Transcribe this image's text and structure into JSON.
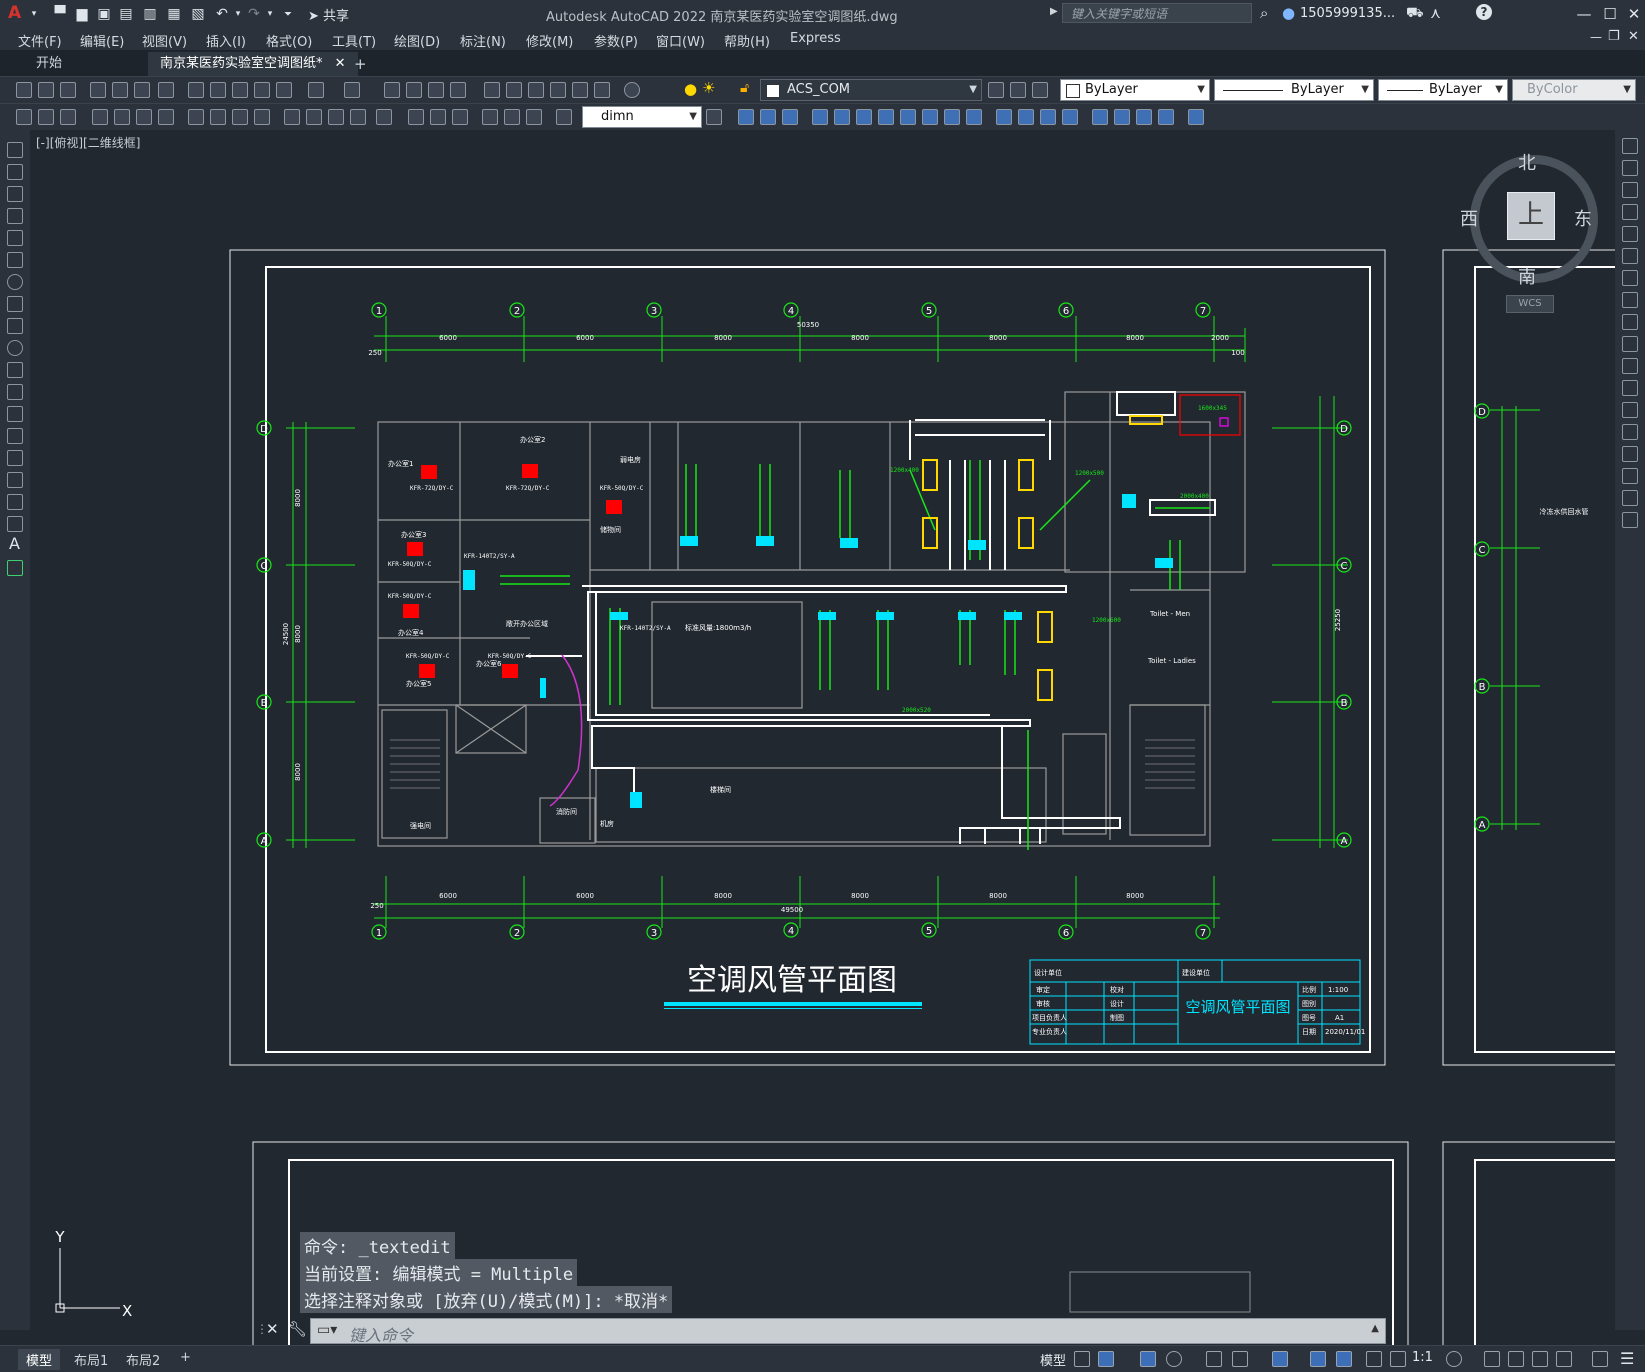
{
  "app": {
    "logo_letter": "A",
    "window_title": "Autodesk AutoCAD 2022    南京某医药实验室空调图纸.dwg",
    "share_label": "共享",
    "search_placeholder": "键入关键字或短语",
    "user_id": "1505999135...",
    "colors": {
      "accent_red": "#d8322c",
      "drawing_bg": "#212830",
      "green": "#19e619",
      "cyan": "#00e5ff",
      "red": "#ff0000",
      "yellow": "#ffd800",
      "white": "#ffffff"
    }
  },
  "menu": [
    "文件(F)",
    "编辑(E)",
    "视图(V)",
    "插入(I)",
    "格式(O)",
    "工具(T)",
    "绘图(D)",
    "标注(N)",
    "修改(M)",
    "参数(P)",
    "窗口(W)",
    "帮助(H)",
    "Express"
  ],
  "tabs": {
    "start": "开始",
    "file": "南京某医药实验室空调图纸*",
    "add": "+"
  },
  "toolbar": {
    "layer": "ACS_COM",
    "color": "ByLayer",
    "linetype": "ByLayer",
    "lineweight": "ByLayer",
    "plotstyle": "ByColor",
    "dimstyle": "dimn"
  },
  "viewport": {
    "label": "[-][俯视][二维线框]"
  },
  "viewcube": {
    "north": "北",
    "south": "南",
    "east": "东",
    "west": "西",
    "face": "上",
    "wcs": "WCS"
  },
  "drawing": {
    "title": "空调风管平面图",
    "axes_numbers": [
      "1",
      "2",
      "3",
      "4",
      "5",
      "6",
      "7"
    ],
    "axes_letters": [
      "D",
      "C",
      "B",
      "A"
    ],
    "top_dims": [
      "6000",
      "6000",
      "8000",
      "8000",
      "8000",
      "8000",
      "2000"
    ],
    "top_total": "50350",
    "top_left_end": "250",
    "top_right_end": "100",
    "bottom_dims": [
      "6000",
      "6000",
      "8000",
      "8000",
      "8000",
      "8000"
    ],
    "bottom_total": "49500",
    "bottom_left_end": "250",
    "left_dims": [
      "8000",
      "8000",
      "8000"
    ],
    "left_total": "24500",
    "right_total": "25250",
    "rooms": {
      "office1": "办公室1",
      "office2": "办公室2",
      "office3": "办公室3",
      "office4": "办公室4",
      "office5": "办公室5",
      "office6": "办公室6",
      "open_office": "敞开办公区域",
      "power_room": "弱电房",
      "storage": "储物间",
      "stair_room": "楼梯间",
      "toilet_men": "Toilet - Men",
      "toilet_ladies": "Toilet - Ladies",
      "machine_room": "机房",
      "fire_room": "消防间",
      "elevator_room": "强电间",
      "airflow_note": "标准风量:1800m3/h"
    },
    "units": [
      "KFR-72Q/DY-C",
      "KFR-72Q/DY-C",
      "KFR-50Q/DY-C",
      "KFR-50Q/DY-C",
      "KFR-140T2/SY-A",
      "KFR-50Q/DY-C",
      "KFR-50Q/DY-C",
      "KFR-140T2/SY-A",
      "KFR-50Q/DY-C"
    ],
    "duct_sizes": [
      "1200x400",
      "1600x345",
      "1200x500",
      "2000x520",
      "2000x400",
      "1200x600"
    ],
    "title_block": {
      "design_unit": "设计单位",
      "project": "建设单位",
      "name": "空调风管平面图",
      "scale_label": "比例",
      "scale": "1:100",
      "drawing_no_label": "图别",
      "drawing_no": "图号",
      "sheet": "A1",
      "date_label": "日期",
      "date": "2020/11/01",
      "approved": "审定",
      "checked": "审核",
      "project_lead": "项目负责人",
      "discipline_lead": "专业负责人",
      "proofread": "校对",
      "designer": "设计",
      "drawn": "制图"
    },
    "right_note": "冷冻水供回水管"
  },
  "command": {
    "history": [
      "命令: _textedit",
      "当前设置: 编辑模式 = Multiple",
      "选择注释对象或 [放弃(U)/模式(M)]: *取消*"
    ],
    "placeholder": "键入命令"
  },
  "ucs": {
    "x": "X",
    "y": "Y"
  },
  "status": {
    "layout_tabs": [
      "模型",
      "布局1",
      "布局2"
    ],
    "add": "+",
    "model": "模型",
    "scale": "1:1"
  }
}
